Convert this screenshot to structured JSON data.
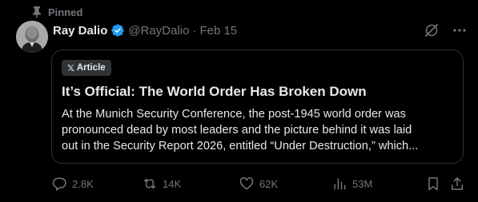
{
  "pinned_label": "Pinned",
  "author": {
    "name": "Ray Dalio",
    "handle": "@RayDalio",
    "separator": "·",
    "date": "Feb 15",
    "verified_color": "#1d9bf0"
  },
  "article": {
    "badge_logo": "𝕏",
    "badge_label": "Article",
    "title": "It’s Official: The World Order Has Broken Down",
    "body_lines": [
      "At the Munich Security Conference, the post-1945 world order was",
      "pronounced dead by most leaders and the picture behind it was laid",
      "out in the Security Report 2026, entitled “Under Destruction,” which..."
    ]
  },
  "stats": {
    "replies": "2.8K",
    "reposts": "14K",
    "likes": "62K",
    "views": "53M"
  },
  "icons": {
    "pinned": "pin-icon",
    "verified": "verified-badge-icon",
    "grok": "grok-icon",
    "more": "more-icon",
    "reply": "reply-icon",
    "repost": "repost-icon",
    "like": "heart-icon",
    "views": "views-icon",
    "bookmark": "bookmark-icon",
    "share": "share-icon"
  },
  "colors": {
    "background": "#000000",
    "text": "#e7e9ea",
    "muted": "#71767b",
    "border": "#2f3336"
  }
}
